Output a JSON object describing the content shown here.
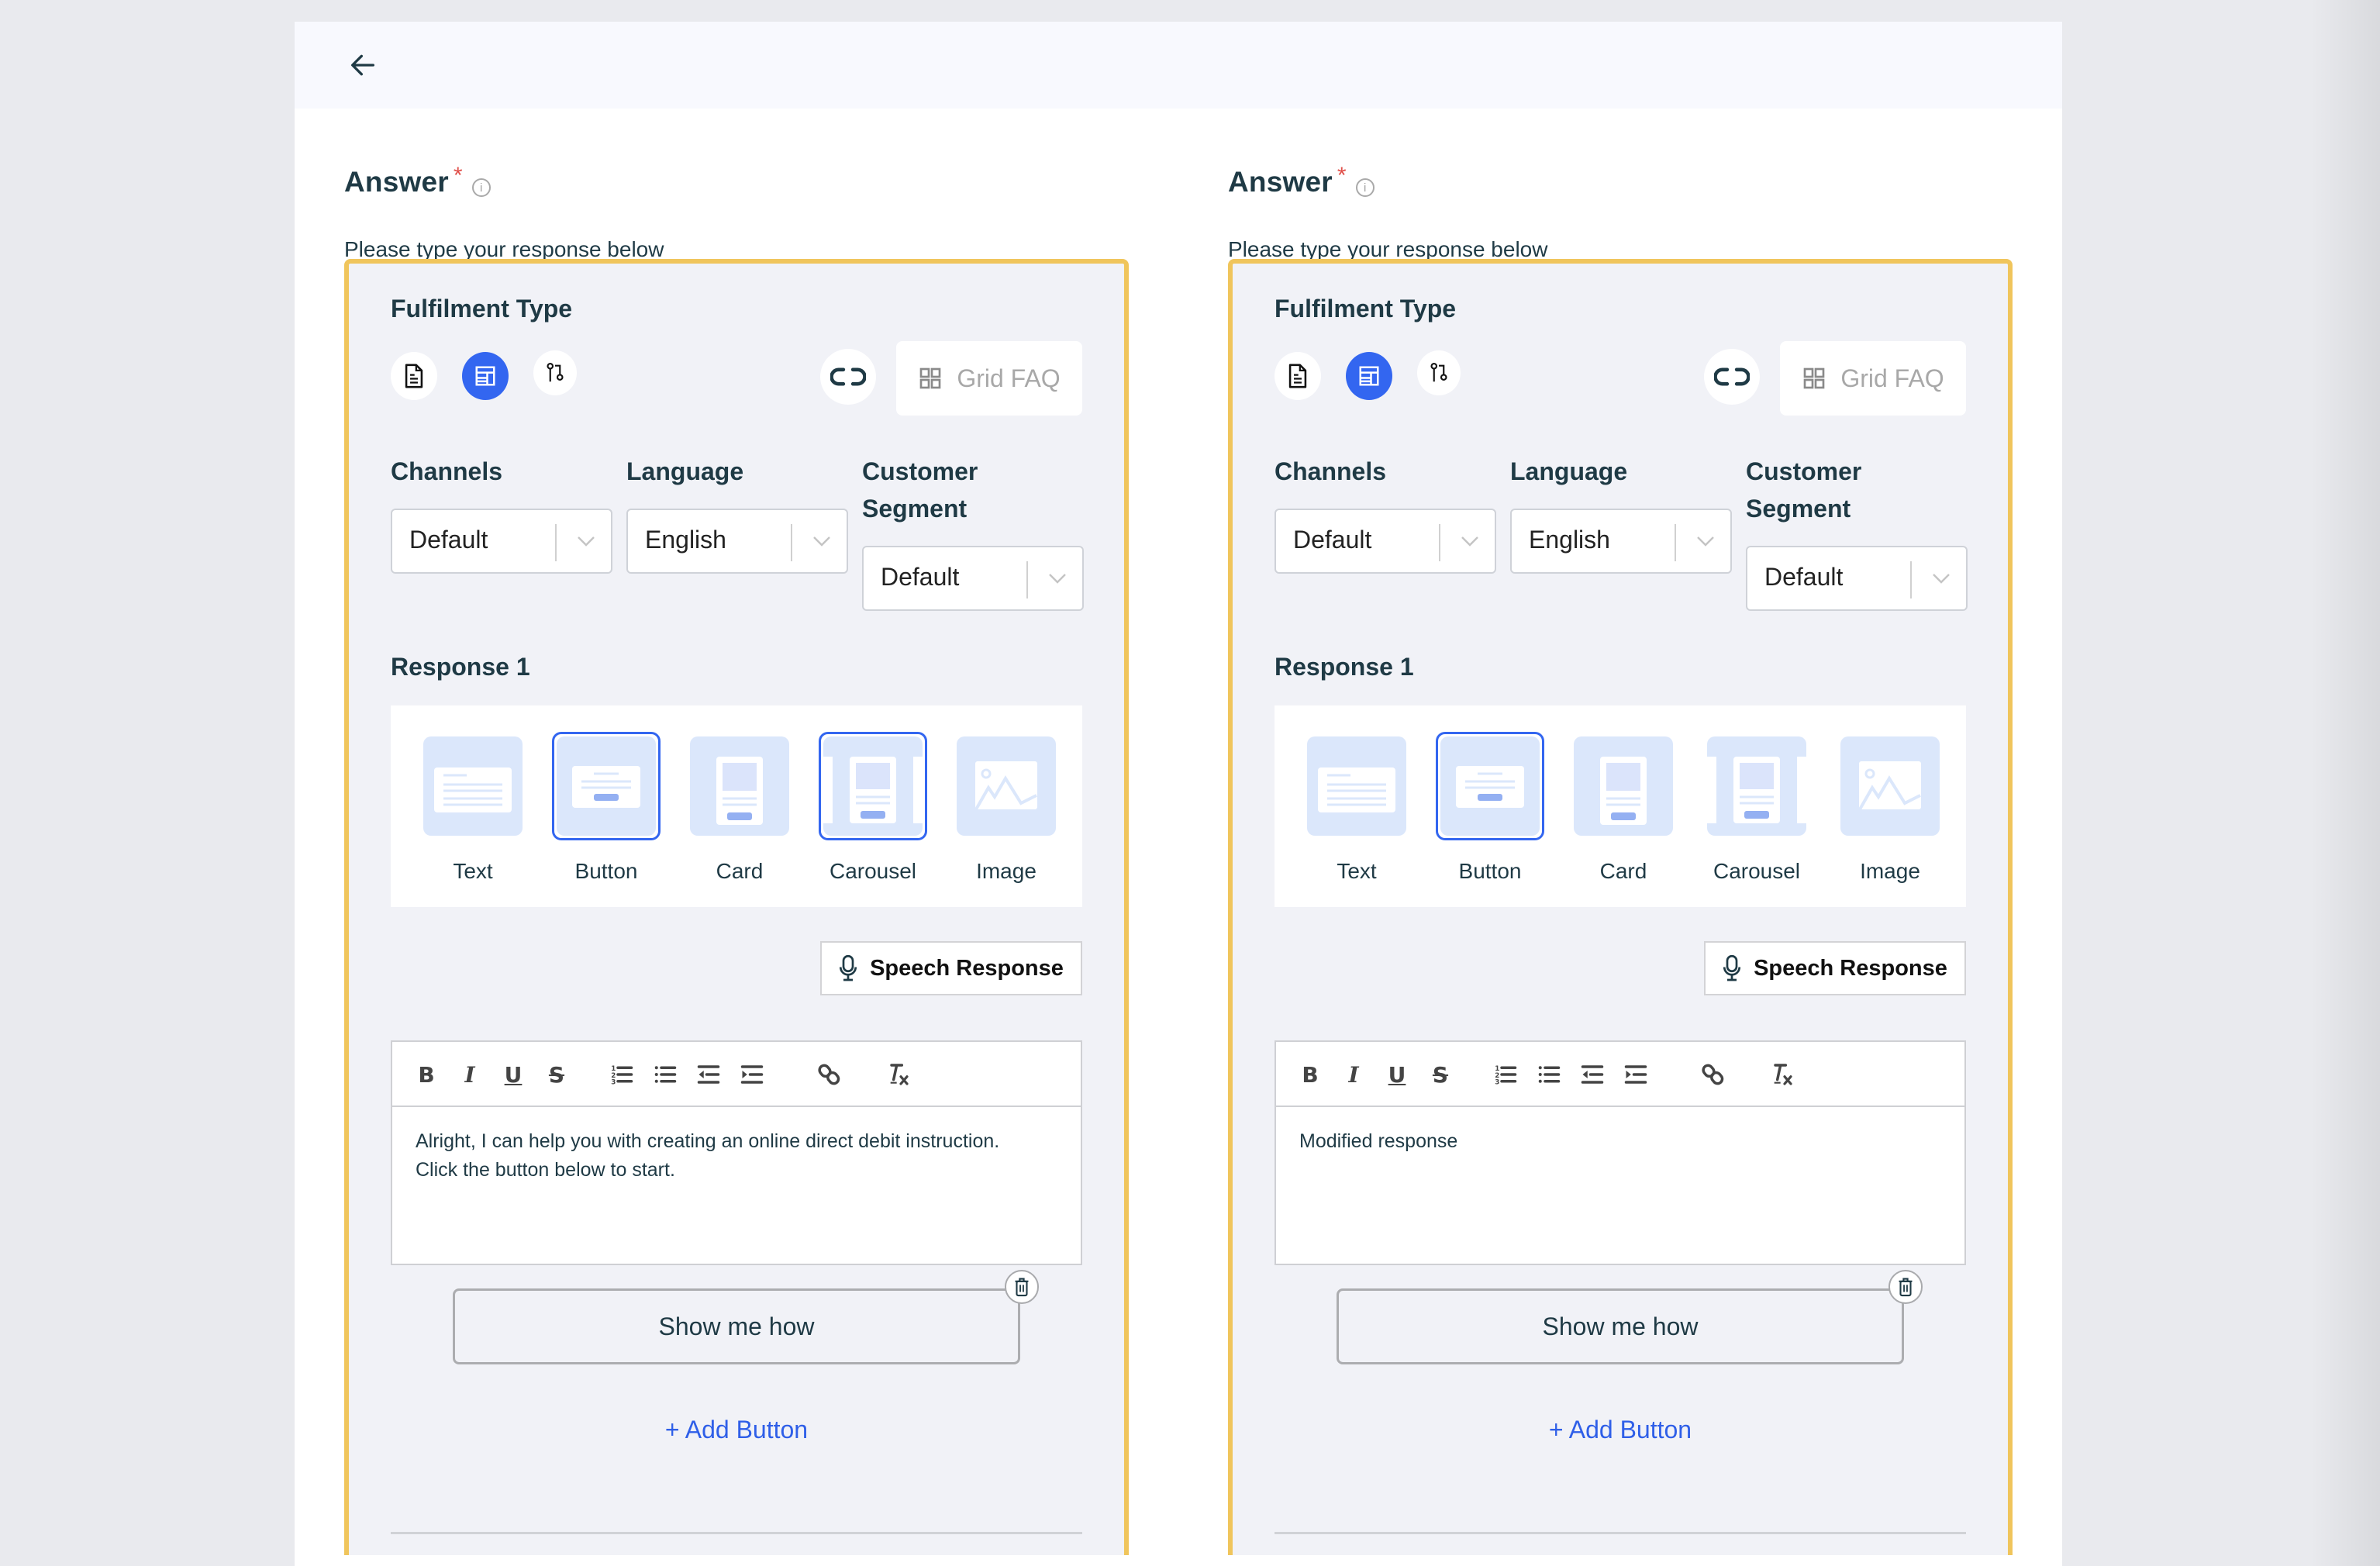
{
  "header": {
    "back_icon": "arrow-left-icon"
  },
  "colors": {
    "accent": "#3366f0",
    "highlight_border": "#f0c55c",
    "required_mark": "#e0504a",
    "link": "#2f5fe8"
  },
  "panels": [
    {
      "answer_label": "Answer",
      "required_mark": "*",
      "info_icon": "info-icon",
      "subtitle": "Please type your response below",
      "fulfilment": {
        "label": "Fulfilment Type",
        "types": [
          {
            "icon": "document-icon",
            "active": false
          },
          {
            "icon": "layout-template-icon",
            "active": true
          },
          {
            "icon": "flow-branch-icon",
            "active": false
          }
        ],
        "link_icon": "link-icon",
        "grid_faq_label": "Grid FAQ",
        "grid_faq_icon": "grid-icon"
      },
      "selects": {
        "channels": {
          "label": "Channels",
          "value": "Default"
        },
        "language": {
          "label": "Language",
          "value": "English"
        },
        "segment": {
          "label_line1": "Customer",
          "label_line2": "Segment",
          "value": "Default"
        }
      },
      "response": {
        "label": "Response 1",
        "types": [
          {
            "name": "Text",
            "selected": false
          },
          {
            "name": "Button",
            "selected": true
          },
          {
            "name": "Card",
            "selected": false
          },
          {
            "name": "Carousel",
            "selected": true
          },
          {
            "name": "Image",
            "selected": false
          }
        ]
      },
      "speech_response_label": "Speech Response",
      "editor": {
        "toolbar": [
          "bold",
          "italic",
          "underline",
          "strikethrough",
          "ordered-list",
          "bullet-list",
          "outdent",
          "indent",
          "link",
          "clear-format"
        ],
        "content_line1": "Alright, I can help you with creating an online direct debit instruction.",
        "content_line2": "Click the button below to start."
      },
      "button_preview_label": "Show me how",
      "add_button_label": "+ Add Button"
    },
    {
      "answer_label": "Answer",
      "required_mark": "*",
      "info_icon": "info-icon",
      "subtitle": "Please type your response below",
      "fulfilment": {
        "label": "Fulfilment Type",
        "types": [
          {
            "icon": "document-icon",
            "active": false
          },
          {
            "icon": "layout-template-icon",
            "active": true
          },
          {
            "icon": "flow-branch-icon",
            "active": false
          }
        ],
        "link_icon": "link-icon",
        "grid_faq_label": "Grid FAQ",
        "grid_faq_icon": "grid-icon"
      },
      "selects": {
        "channels": {
          "label": "Channels",
          "value": "Default"
        },
        "language": {
          "label": "Language",
          "value": "English"
        },
        "segment": {
          "label_line1": "Customer",
          "label_line2": "Segment",
          "value": "Default"
        }
      },
      "response": {
        "label": "Response 1",
        "types": [
          {
            "name": "Text",
            "selected": false
          },
          {
            "name": "Button",
            "selected": true
          },
          {
            "name": "Card",
            "selected": false
          },
          {
            "name": "Carousel",
            "selected": false
          },
          {
            "name": "Image",
            "selected": false
          }
        ]
      },
      "speech_response_label": "Speech Response",
      "editor": {
        "toolbar": [
          "bold",
          "italic",
          "underline",
          "strikethrough",
          "ordered-list",
          "bullet-list",
          "outdent",
          "indent",
          "link",
          "clear-format"
        ],
        "content_line1": "Modified response",
        "content_line2": ""
      },
      "button_preview_label": "Show me how",
      "add_button_label": "+ Add Button"
    }
  ]
}
